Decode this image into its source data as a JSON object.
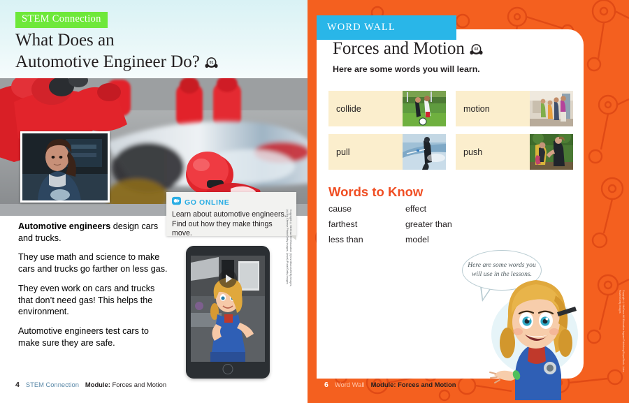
{
  "colors": {
    "stem_green": "#6ee83a",
    "word_wall_blue": "#29b6e8",
    "orange_bg": "#f4601f",
    "words_to_know_orange": "#f04e23",
    "go_online_blue": "#29ade4",
    "card_cream": "#fbeecd"
  },
  "left_page": {
    "badge": "STEM Connection",
    "title_line1": "What Does an",
    "title_line2": "Automotive Engineer Do?",
    "audio_icon": "headphones-icon",
    "audio_track": "01",
    "race_photo_alt": "pit-crew-race-car-photo",
    "inset_photo_alt": "engineer-woman-photo",
    "go_online": {
      "icon": "go-online-icon",
      "label": "GO ONLINE",
      "body": "Learn about automotive engineers. Find out how they make things move."
    },
    "paragraphs": [
      {
        "bold": "Automotive engineers",
        "rest": " design cars and trucks."
      },
      {
        "bold": "",
        "rest": "They use math and science to make cars and trucks go farther on less gas."
      },
      {
        "bold": "",
        "rest": "They even work on cars and trucks that don’t need gas! This helps the environment."
      },
      {
        "bold": "",
        "rest": "Automotive engineers test cars to make sure they are safe."
      }
    ],
    "tablet": {
      "alt": "tablet-video-preview",
      "play_icon": "play-icon"
    },
    "credit": "Copyright © McGraw-Hill Education (t) Iris Marcos/Getty Images, (c) Big Cheese Photo/Getty Images, (inset) Pixtal/Getty Images",
    "footer": {
      "page_number": "4",
      "section": "STEM Connection",
      "module_label": "Module:",
      "module_name": "Forces and Motion"
    }
  },
  "right_page": {
    "tab_label": "WORD WALL",
    "title": "Forces and Motion",
    "audio_icon": "headphones-icon",
    "audio_track": "02",
    "subtitle": "Here are some words you will learn.",
    "word_cards": [
      {
        "word": "collide",
        "image": "soccer-players-photo"
      },
      {
        "word": "motion",
        "image": "students-hallway-photo"
      },
      {
        "word": "pull",
        "image": "water-skier-photo"
      },
      {
        "word": "push",
        "image": "boy-pushing-swing-photo"
      }
    ],
    "words_to_know_heading": "Words to Know",
    "words_to_know": [
      "cause",
      "effect",
      "farthest",
      "greater than",
      "less than",
      "model"
    ],
    "speech_bubble": "Here are some words you will use in the lessons.",
    "mascot_alt": "girl-engineer-mascot",
    "credit": "Copyright © McGraw-Hill Education Ingram Publishing/SuperStock, Jules Frazier/Getty Images",
    "footer": {
      "page_number": "6",
      "section": "Word Wall",
      "module_label": "Module:",
      "module_name": "Forces and Motion"
    }
  }
}
